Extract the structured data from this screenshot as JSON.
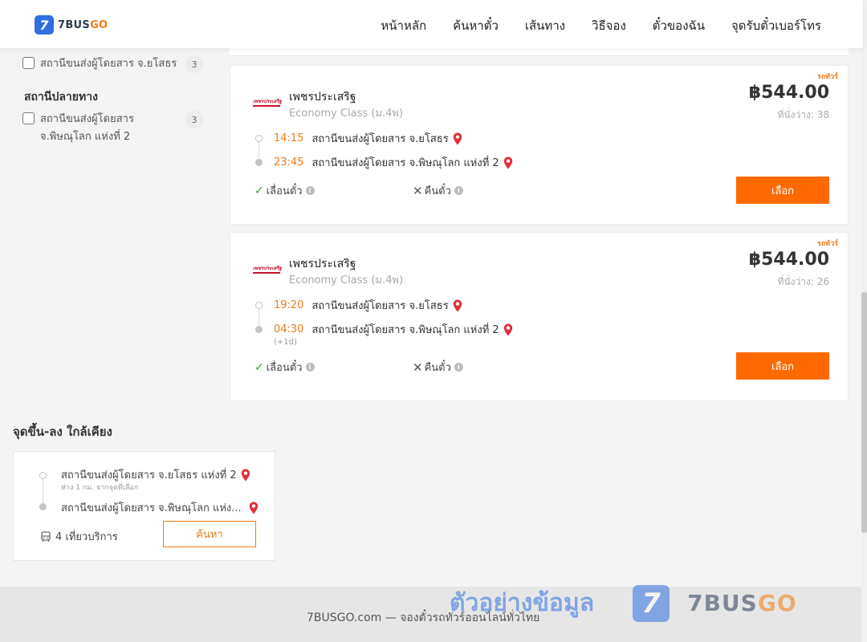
{
  "brand": {
    "badge": "7",
    "name_main": "7BUS",
    "name_accent": "GO"
  },
  "nav": [
    {
      "label": "หน้าหลัก"
    },
    {
      "label": "ค้นหาตั๋ว"
    },
    {
      "label": "เส้นทาง"
    },
    {
      "label": "วิธีจอง"
    },
    {
      "label": "ตั๋วของฉัน"
    },
    {
      "label": "จุดรับตั๋วเบอร์โทร"
    }
  ],
  "filters": {
    "origin_items": [
      {
        "label": "สถานีขนส่งผู้โดยสาร จ.ยโสธร",
        "count": "3"
      }
    ],
    "destination_title": "สถานีปลายทาง",
    "destination_items": [
      {
        "label": "สถานีขนส่งผู้โดยสาร จ.พิษณุโลก แห่งที่ 2",
        "count": "3"
      }
    ]
  },
  "trips": [
    {
      "badge": "รถทัวร์",
      "operator": "เพชรประเสริฐ",
      "operator_logo_text": "เพชรประเสริฐ",
      "bus_class": "Economy Class (ม.4พ)",
      "price": "฿544.00",
      "seats": "ที่นั่งว่าง: 38",
      "depart_time": "14:15",
      "depart_stop": "สถานีขนส่งผู้โดยสาร จ.ยโสธร",
      "arrive_time": "23:45",
      "arrive_stop": "สถานีขนส่งผู้โดยสาร จ.พิษณุโลก แห่งที่ 2",
      "next_day": "",
      "policy_change": "เลื่อนตั๋ว",
      "policy_refund": "คืนตั๋ว",
      "select_label": "เลือก"
    },
    {
      "badge": "รถทัวร์",
      "operator": "เพชรประเสริฐ",
      "operator_logo_text": "เพชรประเสริฐ",
      "bus_class": "Economy Class (ม.4พ)",
      "price": "฿544.00",
      "seats": "ที่นั่งว่าง: 26",
      "depart_time": "19:20",
      "depart_stop": "สถานีขนส่งผู้โดยสาร จ.ยโสธร",
      "arrive_time": "04:30",
      "arrive_stop": "สถานีขนส่งผู้โดยสาร จ.พิษณุโลก แห่งที่ 2",
      "next_day": "(+1d)",
      "policy_change": "เลื่อนตั๋ว",
      "policy_refund": "คืนตั๋ว",
      "select_label": "เลือก"
    }
  ],
  "nearby": {
    "title": "จุดขึ้น-ลง ใกล้เคียง",
    "from_stop": "สถานีขนส่งผู้โดยสาร จ.ยโสธร แห่งที่ 2",
    "from_note": "ห่าง 1 กม. จากจุดที่เลือก",
    "to_stop": "สถานีขนส่งผู้โดยสาร จ.พิษณุโลก แห่ง...",
    "trips": "4 เที่ยวบริการ",
    "search_label": "ค้นหา"
  },
  "footer": {
    "text": "7BUSGO.com — จองตั๋วรถทัวร์ออนไลน์ทั่วไทย"
  },
  "watermark": {
    "text": "ตัวอย่างข้อมูล",
    "badge": "7",
    "brand_main": "7BUS",
    "brand_accent": "GO"
  },
  "colors": {
    "accent": "#ff6a00",
    "orange_text": "#f07b12",
    "brand_blue": "#2f6fe0",
    "pin_red": "#e0303a"
  }
}
